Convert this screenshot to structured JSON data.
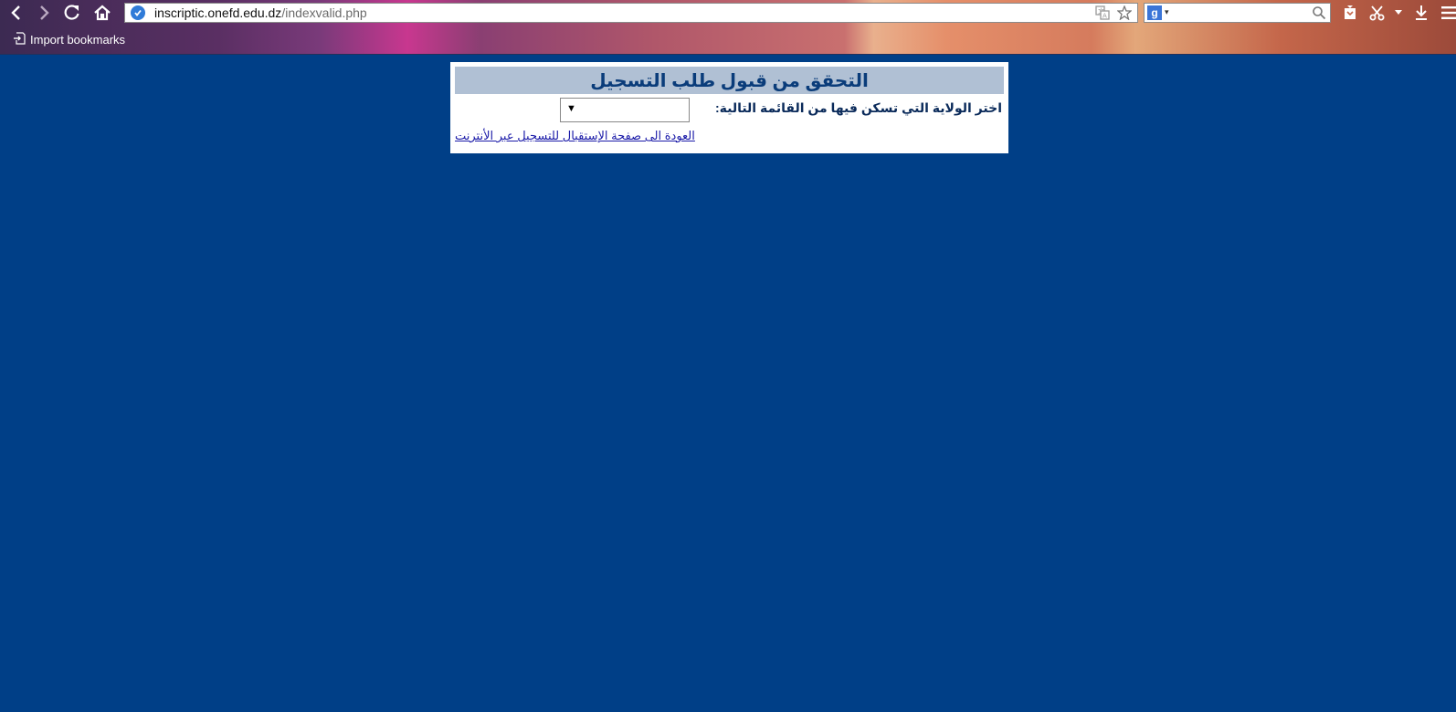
{
  "browser": {
    "url_host": "inscriptic.onefd.edu.dz",
    "url_path": "/indexvalid.php",
    "search_engine_badge": "g",
    "bookmarks": [
      {
        "label": "Import bookmarks",
        "icon": "import-icon"
      }
    ],
    "icons": {
      "back": "back-arrow-icon",
      "forward": "forward-arrow-icon",
      "reload": "reload-icon",
      "home": "home-icon",
      "secure": "verified-check-icon",
      "translate": "translate-icon",
      "bookmark_star": "star-icon",
      "search": "search-icon",
      "pocket": "save-page-icon",
      "screenshot": "scissors-icon",
      "download": "download-icon",
      "menu": "hamburger-menu-icon"
    },
    "colors": {
      "page_background": "#003f87",
      "title_bar": "#b0c0d4",
      "title_text": "#0a3c7a",
      "link": "#1a1aa8"
    }
  },
  "page": {
    "title": "التحقق من قبول طلب التسجيل",
    "select_label": "اختر الولاية التي تسكن فيها من القائمة التالية:",
    "select_value": "",
    "back_link": "العودة الى صفحة الإستقبال للتسجيل عبر الأنترنت"
  }
}
